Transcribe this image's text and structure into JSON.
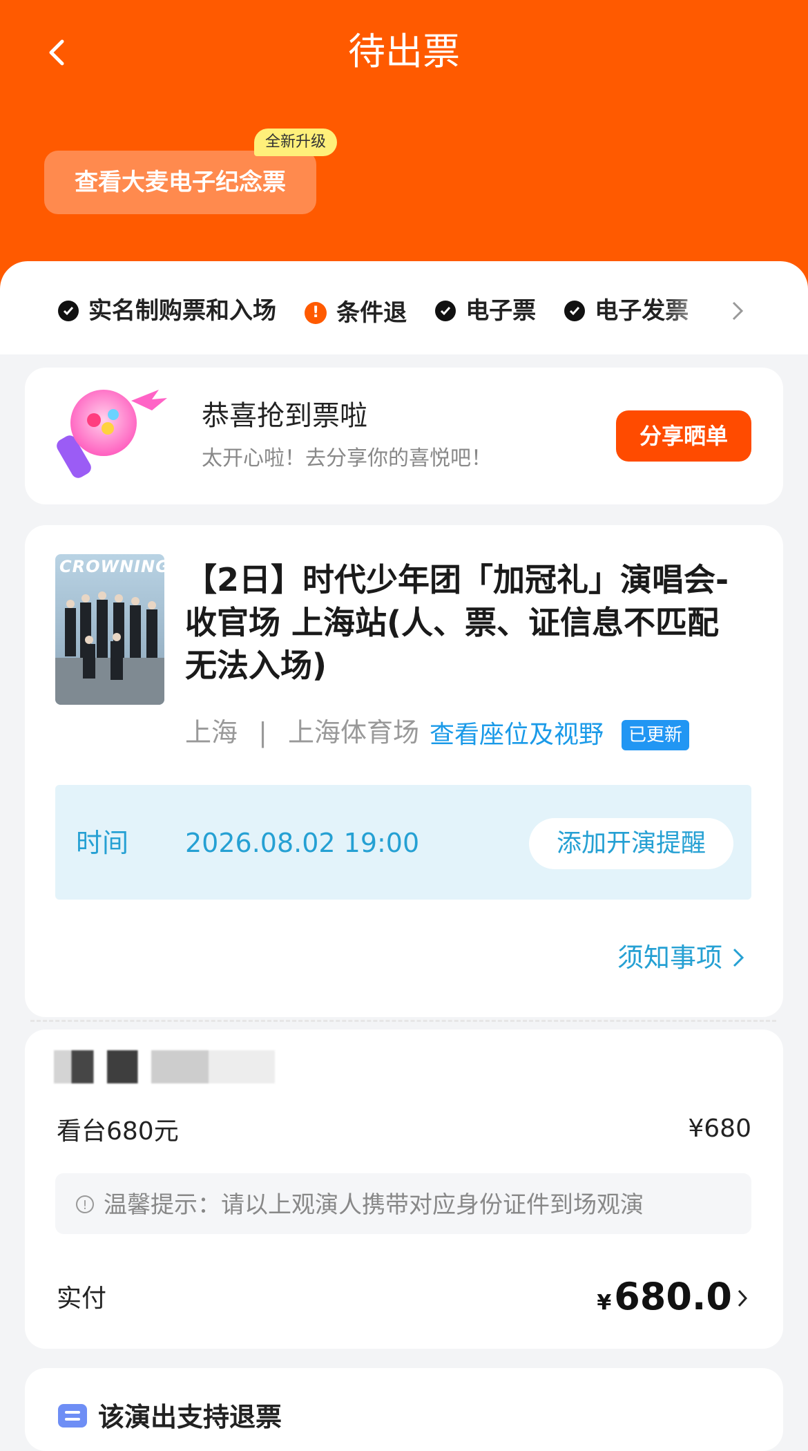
{
  "header": {
    "title": "待出票",
    "souvenir_button": "查看大麦电子纪念票",
    "new_badge": "全新升级",
    "accent_color": "#ff5a00"
  },
  "features": [
    {
      "icon": "check-icon",
      "label": "实名制购票和入场"
    },
    {
      "icon": "warning-icon",
      "label": "条件退"
    },
    {
      "icon": "check-icon",
      "label": "电子票"
    },
    {
      "icon": "check-icon",
      "label": "电子发票"
    }
  ],
  "share": {
    "title": "恭喜抢到票啦",
    "subtitle": "太开心啦！去分享你的喜悦吧！",
    "button": "分享晒单"
  },
  "show": {
    "poster_text": "CROWNING",
    "title": "【2日】时代少年团「加冠礼」演唱会-收官场 上海站(人、票、证信息不匹配无法入场)",
    "city": "上海",
    "separator": "|",
    "venue": "上海体育场",
    "seat_link": "查看座位及视野",
    "updated_badge": "已更新",
    "time_label": "时间",
    "time_value": "2026.08.02 19:00",
    "remind_button": "添加开演提醒",
    "notice_link": "须知事项"
  },
  "order": {
    "item_name": "看台680元",
    "item_price": "¥680",
    "tip_icon": "!",
    "tip": "温馨提示：请以上观演人携带对应身份证件到场观演",
    "paid_label": "实付",
    "paid_currency": "¥",
    "paid_amount": "680.0"
  },
  "refund": {
    "label": "该演出支持退票"
  }
}
